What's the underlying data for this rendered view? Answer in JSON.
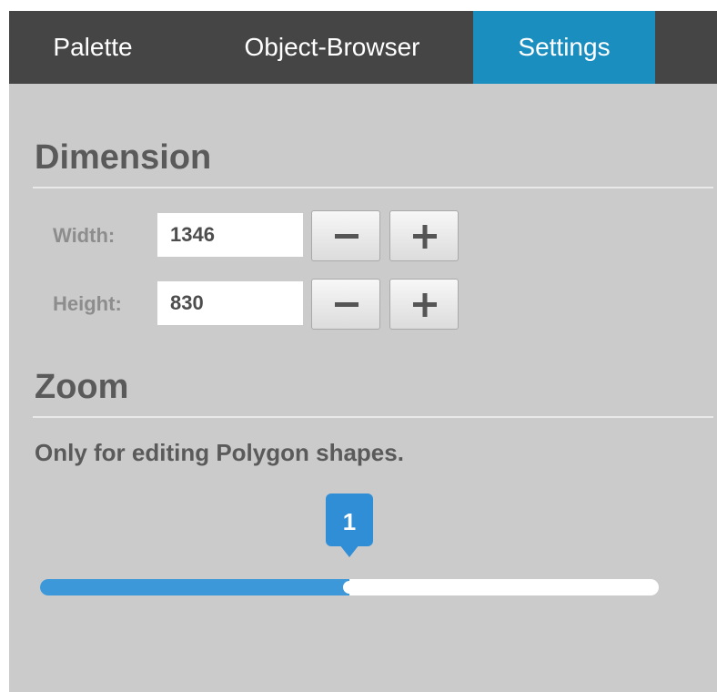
{
  "tabs": [
    {
      "label": "Palette",
      "active": false
    },
    {
      "label": "Object-Browser",
      "active": false
    },
    {
      "label": "Settings",
      "active": true
    }
  ],
  "dimension": {
    "title": "Dimension",
    "width": {
      "label": "Width:",
      "value": "1346",
      "decrement_icon": "minus-icon",
      "increment_icon": "plus-icon"
    },
    "height": {
      "label": "Height:",
      "value": "830",
      "decrement_icon": "minus-icon",
      "increment_icon": "plus-icon"
    }
  },
  "zoom": {
    "title": "Zoom",
    "hint": "Only for editing Polygon shapes.",
    "slider": {
      "value": "1",
      "fill_fraction": 0.5
    }
  },
  "colors": {
    "accent": "#1b8ec0",
    "slider_fill": "#3c98d9",
    "tabbar": "#454545",
    "panel": "#cbcbcb"
  }
}
